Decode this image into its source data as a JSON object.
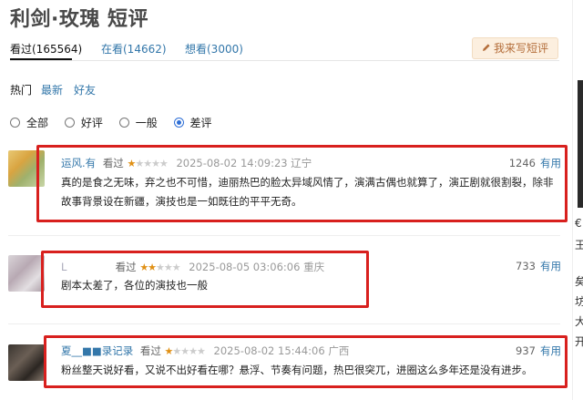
{
  "title": "利剑·玫瑰 短评",
  "tabs": [
    {
      "label": "看过(165564)"
    },
    {
      "label": "在看(14662)"
    },
    {
      "label": "想看(3000)"
    }
  ],
  "write_button": {
    "icon": "pencil-icon",
    "label": "我来写短评"
  },
  "sort_options": [
    "热门",
    "最新",
    "好友"
  ],
  "filters": [
    {
      "label": "全部",
      "selected": false
    },
    {
      "label": "好评",
      "selected": false
    },
    {
      "label": "一般",
      "selected": false
    },
    {
      "label": "差评",
      "selected": true
    }
  ],
  "reviews": [
    {
      "user": "运风.有",
      "status": "看过",
      "rating": 1,
      "time": "2025-08-02 14:09:23",
      "location": "辽宁",
      "votes": "1246",
      "useful_label": "有用",
      "content": "真的是食之无味，弃之也不可惜，迪丽热巴的脸太异域风情了，演满古偶也就算了，演正剧就很割裂，除非故事背景设在新疆，演技也是一如既往的平平无奇。"
    },
    {
      "user": "L",
      "status": "看过",
      "rating": 2,
      "time": "2025-08-05 03:06:06",
      "location": "重庆",
      "votes": "733",
      "useful_label": "有用",
      "content": "剧本太差了，各位的演技也一般"
    },
    {
      "user": "夏__■■录记录",
      "status": "看过",
      "rating": 1,
      "time": "2025-08-02 15:44:06",
      "location": "广西",
      "votes": "937",
      "useful_label": "有用",
      "content": "粉丝整天说好看，又说不出好看在哪？悬浮、节奏有问题，热巴很突兀，进圈这么多年还是没有进步。"
    }
  ],
  "right_fragments": [
    "€",
    "王",
    "矣",
    "坊",
    "大",
    "开"
  ]
}
